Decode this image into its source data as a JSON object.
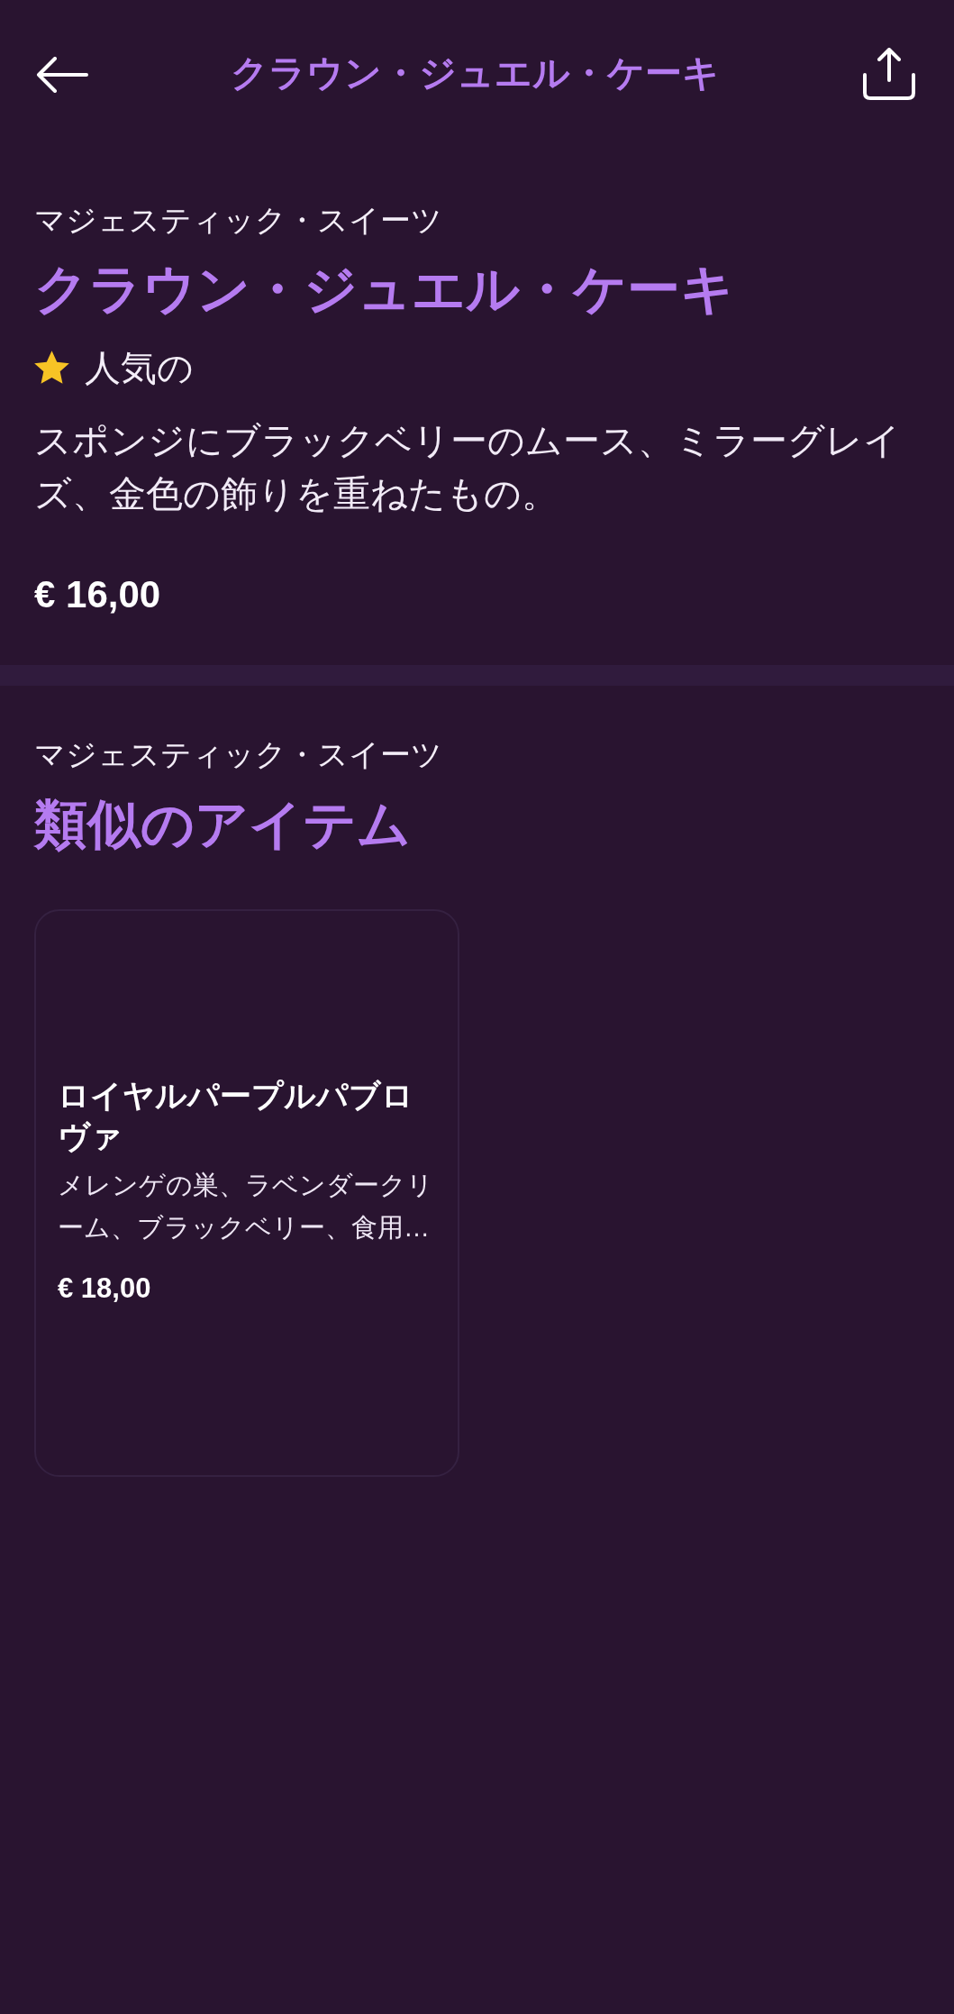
{
  "header": {
    "title": "クラウン・ジュエル・ケーキ"
  },
  "product": {
    "brand": "マジェスティック・スイーツ",
    "name": "クラウン・ジュエル・ケーキ",
    "badge": {
      "label": "人気の"
    },
    "description": "スポンジにブラックベリーのムース、ミラーグレイズ、金色の飾りを重ねたもの。",
    "price": "€ 16,00"
  },
  "similar": {
    "brand": "マジェスティック・スイーツ",
    "title": "類似のアイテム",
    "items": [
      {
        "name": "ロイヤルパープルパブロヴァ",
        "description": "メレンゲの巣、ラベンダークリーム、ブラックベリー、食用…",
        "price": "€ 18,00"
      }
    ]
  }
}
